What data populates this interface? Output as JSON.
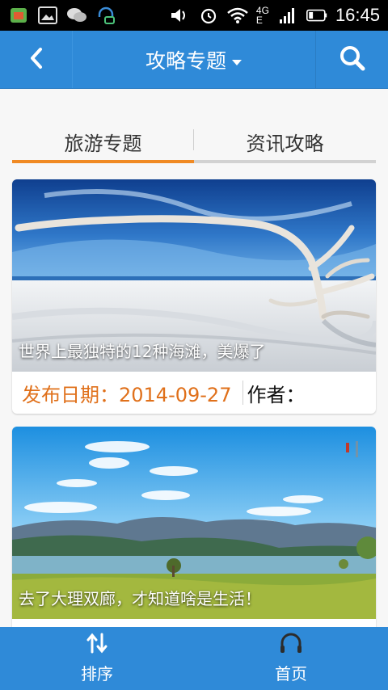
{
  "status_bar": {
    "time": "16:45",
    "network": "4G",
    "network_sub": "E",
    "icons": [
      "android-alert-icon",
      "gallery-icon",
      "wechat-icon",
      "headset-icon",
      "volume-icon",
      "alarm-icon",
      "wifi-icon",
      "signal-icon",
      "battery-icon"
    ]
  },
  "header": {
    "title": "攻略专题",
    "back_icon": "chevron-left-icon",
    "dropdown_icon": "caret-down-icon",
    "search_icon": "search-icon",
    "color": "#2f8ad8"
  },
  "tabs": [
    {
      "label": "旅游专题",
      "active": true
    },
    {
      "label": "资讯攻略",
      "active": false
    }
  ],
  "tab_active_color": "#f08a24",
  "articles": [
    {
      "caption": "世界上最独特的12种海滩，美爆了",
      "date_label": "发布日期：2014-09-27",
      "author_label": "作者："
    },
    {
      "caption": "去了大理双廊，才知道啥是生活！",
      "date_label": "",
      "author_label": ""
    }
  ],
  "bottom_bar": {
    "sort_label": "排序",
    "home_label": "首页",
    "sort_icon": "sort-arrows-icon",
    "home_icon": "headphones-icon"
  }
}
